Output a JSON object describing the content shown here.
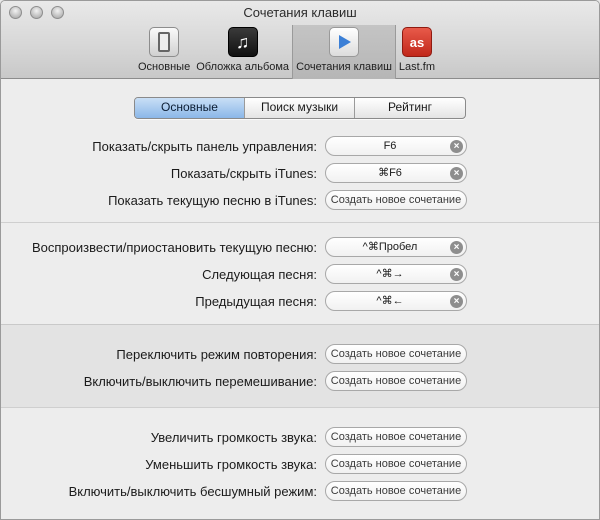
{
  "window": {
    "title": "Сочетания клавиш"
  },
  "toolbar": {
    "items": [
      {
        "label": "Основные"
      },
      {
        "label": "Обложка альбома"
      },
      {
        "label": "Сочетания клавиш"
      },
      {
        "label": "Last.fm"
      }
    ]
  },
  "tabs": [
    {
      "label": "Основные"
    },
    {
      "label": "Поиск музыки"
    },
    {
      "label": "Рейтинг"
    }
  ],
  "groups": [
    {
      "rows": [
        {
          "label": "Показать/скрыть панель управления:",
          "shortcut": "F6"
        },
        {
          "label": "Показать/скрыть iTunes:",
          "shortcut": "⌘F6"
        },
        {
          "label": "Показать текущую песню в iTunes:",
          "shortcut": "Создать новое сочетание"
        }
      ]
    },
    {
      "rows": [
        {
          "label": "Воспроизвести/приостановить текущую песню:",
          "shortcut": "^⌘Пробел"
        },
        {
          "label": "Следующая песня:",
          "shortcut": "^⌘→"
        },
        {
          "label": "Предыдущая песня:",
          "shortcut": "^⌘←"
        }
      ]
    },
    {
      "rows": [
        {
          "label": "Переключить режим повторения:",
          "shortcut": "Создать новое сочетание"
        },
        {
          "label": "Включить/выключить перемешивание:",
          "shortcut": "Создать новое сочетание"
        }
      ]
    },
    {
      "rows": [
        {
          "label": "Увеличить громкость звука:",
          "shortcut": "Создать новое сочетание"
        },
        {
          "label": "Уменьшить громкость звука:",
          "shortcut": "Создать новое сочетание"
        },
        {
          "label": "Включить/выключить бесшумный режим:",
          "shortcut": "Создать новое сочетание"
        }
      ]
    }
  ],
  "clear_glyph": "×",
  "icons": {
    "close": "close-button-icon",
    "minimize": "minimize-button-icon",
    "zoom": "zoom-button-icon",
    "general": "switch-icon",
    "art": "music-note-icon",
    "shortcuts": "play-icon",
    "lastfm": "lastfm-icon"
  },
  "colors": {
    "tab_selected": "#8bb7e8",
    "clear_button": "#8e8e8e",
    "lastfm": "#d23a2b"
  }
}
